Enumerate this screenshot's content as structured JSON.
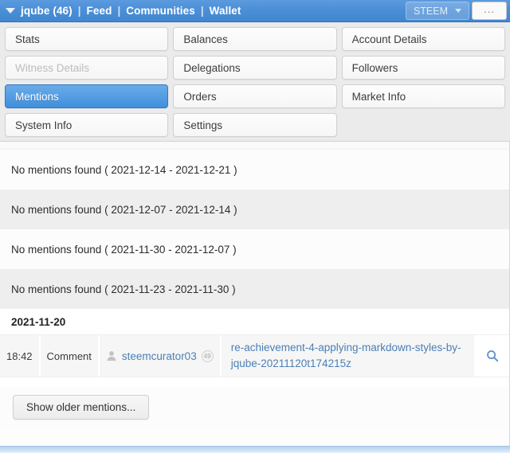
{
  "navbar": {
    "caret_icon": "chevron-down-icon",
    "account": "jqube (46)",
    "sep": "|",
    "links": [
      {
        "label": "Feed"
      },
      {
        "label": "Communities"
      },
      {
        "label": "Wallet"
      }
    ],
    "currency_selector": {
      "label": "STEEM",
      "caret_icon": "chevron-down-icon"
    },
    "more_label": "..."
  },
  "tabs": [
    {
      "label": "Stats",
      "state": "normal"
    },
    {
      "label": "Balances",
      "state": "normal"
    },
    {
      "label": "Account Details",
      "state": "normal"
    },
    {
      "label": "Witness Details",
      "state": "disabled"
    },
    {
      "label": "Delegations",
      "state": "normal"
    },
    {
      "label": "Followers",
      "state": "normal"
    },
    {
      "label": "Mentions",
      "state": "active"
    },
    {
      "label": "Orders",
      "state": "normal"
    },
    {
      "label": "Market Info",
      "state": "normal"
    },
    {
      "label": "System Info",
      "state": "normal"
    },
    {
      "label": "Settings",
      "state": "normal"
    },
    {
      "label": "",
      "state": "empty"
    }
  ],
  "mentions": {
    "empty_periods": [
      {
        "text": "No mentions found ( 2021-12-14 - 2021-12-21 )"
      },
      {
        "text": "No mentions found ( 2021-12-07 - 2021-12-14 )"
      },
      {
        "text": "No mentions found ( 2021-11-30 - 2021-12-07 )"
      },
      {
        "text": "No mentions found ( 2021-11-23 - 2021-11-30 )"
      }
    ],
    "date_header": "2021-11-20",
    "entry": {
      "time": "18:42",
      "type": "Comment",
      "author_icon": "person-icon",
      "author": "steemcurator03",
      "reputation": "49",
      "title": "re-achievement-4-applying-markdown-styles-by-jqube-20211120t174215z",
      "search_icon": "search-icon"
    },
    "show_older_label": "Show older mentions..."
  },
  "colors": {
    "navbar_blue": "#4a8ed6",
    "active_tab_blue": "#3f8fdd",
    "link_blue": "#4a7fb5",
    "statusbar_blue": "#b7d3ee"
  }
}
